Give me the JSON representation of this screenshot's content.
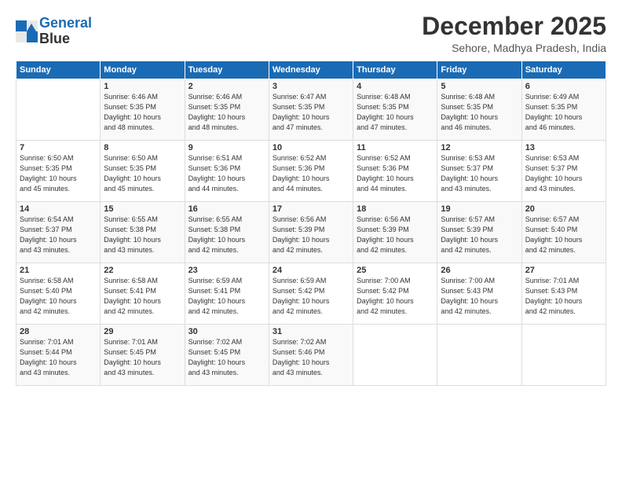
{
  "logo": {
    "line1": "General",
    "line2": "Blue"
  },
  "title": "December 2025",
  "subtitle": "Sehore, Madhya Pradesh, India",
  "weekdays": [
    "Sunday",
    "Monday",
    "Tuesday",
    "Wednesday",
    "Thursday",
    "Friday",
    "Saturday"
  ],
  "weeks": [
    [
      {
        "day": "",
        "info": ""
      },
      {
        "day": "1",
        "info": "Sunrise: 6:46 AM\nSunset: 5:35 PM\nDaylight: 10 hours\nand 48 minutes."
      },
      {
        "day": "2",
        "info": "Sunrise: 6:46 AM\nSunset: 5:35 PM\nDaylight: 10 hours\nand 48 minutes."
      },
      {
        "day": "3",
        "info": "Sunrise: 6:47 AM\nSunset: 5:35 PM\nDaylight: 10 hours\nand 47 minutes."
      },
      {
        "day": "4",
        "info": "Sunrise: 6:48 AM\nSunset: 5:35 PM\nDaylight: 10 hours\nand 47 minutes."
      },
      {
        "day": "5",
        "info": "Sunrise: 6:48 AM\nSunset: 5:35 PM\nDaylight: 10 hours\nand 46 minutes."
      },
      {
        "day": "6",
        "info": "Sunrise: 6:49 AM\nSunset: 5:35 PM\nDaylight: 10 hours\nand 46 minutes."
      }
    ],
    [
      {
        "day": "7",
        "info": "Sunrise: 6:50 AM\nSunset: 5:35 PM\nDaylight: 10 hours\nand 45 minutes."
      },
      {
        "day": "8",
        "info": "Sunrise: 6:50 AM\nSunset: 5:35 PM\nDaylight: 10 hours\nand 45 minutes."
      },
      {
        "day": "9",
        "info": "Sunrise: 6:51 AM\nSunset: 5:36 PM\nDaylight: 10 hours\nand 44 minutes."
      },
      {
        "day": "10",
        "info": "Sunrise: 6:52 AM\nSunset: 5:36 PM\nDaylight: 10 hours\nand 44 minutes."
      },
      {
        "day": "11",
        "info": "Sunrise: 6:52 AM\nSunset: 5:36 PM\nDaylight: 10 hours\nand 44 minutes."
      },
      {
        "day": "12",
        "info": "Sunrise: 6:53 AM\nSunset: 5:37 PM\nDaylight: 10 hours\nand 43 minutes."
      },
      {
        "day": "13",
        "info": "Sunrise: 6:53 AM\nSunset: 5:37 PM\nDaylight: 10 hours\nand 43 minutes."
      }
    ],
    [
      {
        "day": "14",
        "info": "Sunrise: 6:54 AM\nSunset: 5:37 PM\nDaylight: 10 hours\nand 43 minutes."
      },
      {
        "day": "15",
        "info": "Sunrise: 6:55 AM\nSunset: 5:38 PM\nDaylight: 10 hours\nand 43 minutes."
      },
      {
        "day": "16",
        "info": "Sunrise: 6:55 AM\nSunset: 5:38 PM\nDaylight: 10 hours\nand 42 minutes."
      },
      {
        "day": "17",
        "info": "Sunrise: 6:56 AM\nSunset: 5:39 PM\nDaylight: 10 hours\nand 42 minutes."
      },
      {
        "day": "18",
        "info": "Sunrise: 6:56 AM\nSunset: 5:39 PM\nDaylight: 10 hours\nand 42 minutes."
      },
      {
        "day": "19",
        "info": "Sunrise: 6:57 AM\nSunset: 5:39 PM\nDaylight: 10 hours\nand 42 minutes."
      },
      {
        "day": "20",
        "info": "Sunrise: 6:57 AM\nSunset: 5:40 PM\nDaylight: 10 hours\nand 42 minutes."
      }
    ],
    [
      {
        "day": "21",
        "info": "Sunrise: 6:58 AM\nSunset: 5:40 PM\nDaylight: 10 hours\nand 42 minutes."
      },
      {
        "day": "22",
        "info": "Sunrise: 6:58 AM\nSunset: 5:41 PM\nDaylight: 10 hours\nand 42 minutes."
      },
      {
        "day": "23",
        "info": "Sunrise: 6:59 AM\nSunset: 5:41 PM\nDaylight: 10 hours\nand 42 minutes."
      },
      {
        "day": "24",
        "info": "Sunrise: 6:59 AM\nSunset: 5:42 PM\nDaylight: 10 hours\nand 42 minutes."
      },
      {
        "day": "25",
        "info": "Sunrise: 7:00 AM\nSunset: 5:42 PM\nDaylight: 10 hours\nand 42 minutes."
      },
      {
        "day": "26",
        "info": "Sunrise: 7:00 AM\nSunset: 5:43 PM\nDaylight: 10 hours\nand 42 minutes."
      },
      {
        "day": "27",
        "info": "Sunrise: 7:01 AM\nSunset: 5:43 PM\nDaylight: 10 hours\nand 42 minutes."
      }
    ],
    [
      {
        "day": "28",
        "info": "Sunrise: 7:01 AM\nSunset: 5:44 PM\nDaylight: 10 hours\nand 43 minutes."
      },
      {
        "day": "29",
        "info": "Sunrise: 7:01 AM\nSunset: 5:45 PM\nDaylight: 10 hours\nand 43 minutes."
      },
      {
        "day": "30",
        "info": "Sunrise: 7:02 AM\nSunset: 5:45 PM\nDaylight: 10 hours\nand 43 minutes."
      },
      {
        "day": "31",
        "info": "Sunrise: 7:02 AM\nSunset: 5:46 PM\nDaylight: 10 hours\nand 43 minutes."
      },
      {
        "day": "",
        "info": ""
      },
      {
        "day": "",
        "info": ""
      },
      {
        "day": "",
        "info": ""
      }
    ]
  ]
}
